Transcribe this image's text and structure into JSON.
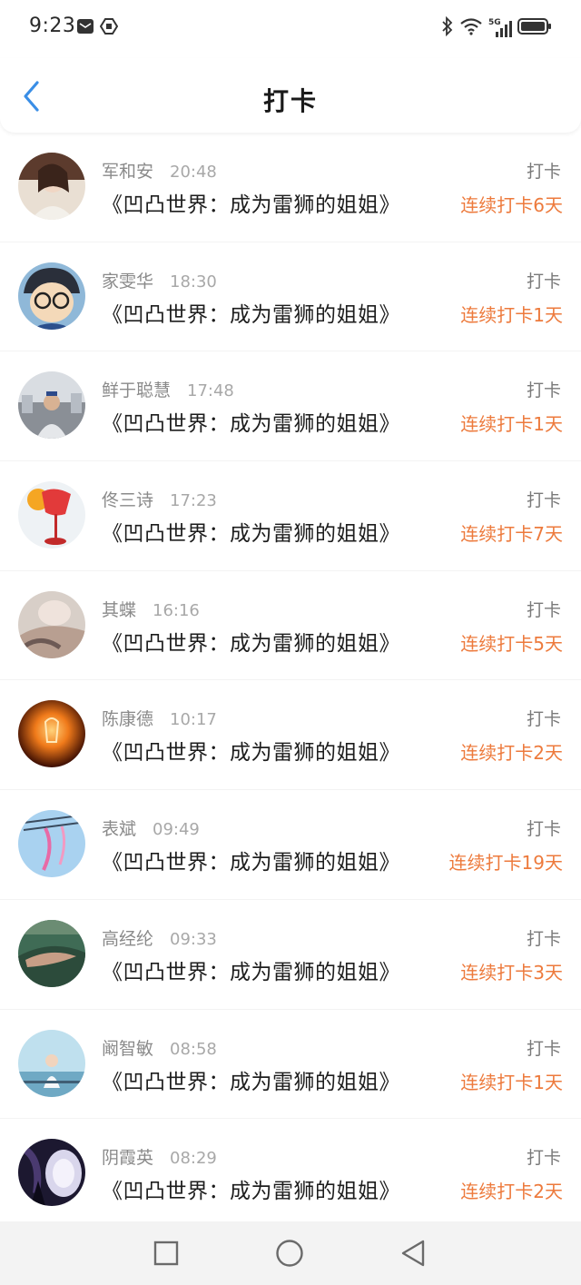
{
  "status_bar": {
    "time": "9:23",
    "network": "5G"
  },
  "header": {
    "title": "打卡"
  },
  "colors": {
    "accent_blue": "#3a8ee6",
    "streak_orange": "#ed7a3c"
  },
  "rows": [
    {
      "user": "军和安",
      "time": "20:48",
      "book": "《凹凸世界：成为雷狮的姐姐》",
      "label": "打卡",
      "streak": "连续打卡6天"
    },
    {
      "user": "家雯华",
      "time": "18:30",
      "book": "《凹凸世界：成为雷狮的姐姐》",
      "label": "打卡",
      "streak": "连续打卡1天"
    },
    {
      "user": "鲜于聪慧",
      "time": "17:48",
      "book": "《凹凸世界：成为雷狮的姐姐》",
      "label": "打卡",
      "streak": "连续打卡1天"
    },
    {
      "user": "佟三诗",
      "time": "17:23",
      "book": "《凹凸世界：成为雷狮的姐姐》",
      "label": "打卡",
      "streak": "连续打卡7天"
    },
    {
      "user": "其蝶",
      "time": "16:16",
      "book": "《凹凸世界：成为雷狮的姐姐》",
      "label": "打卡",
      "streak": "连续打卡5天"
    },
    {
      "user": "陈康德",
      "time": "10:17",
      "book": "《凹凸世界：成为雷狮的姐姐》",
      "label": "打卡",
      "streak": "连续打卡2天"
    },
    {
      "user": "表斌",
      "time": "09:49",
      "book": "《凹凸世界：成为雷狮的姐姐》",
      "label": "打卡",
      "streak": "连续打卡19天"
    },
    {
      "user": "高经纶",
      "time": "09:33",
      "book": "《凹凸世界：成为雷狮的姐姐》",
      "label": "打卡",
      "streak": "连续打卡3天"
    },
    {
      "user": "阚智敏",
      "time": "08:58",
      "book": "《凹凸世界：成为雷狮的姐姐》",
      "label": "打卡",
      "streak": "连续打卡1天"
    },
    {
      "user": "阴霞英",
      "time": "08:29",
      "book": "《凹凸世界：成为雷狮的姐姐》",
      "label": "打卡",
      "streak": "连续打卡2天"
    }
  ]
}
